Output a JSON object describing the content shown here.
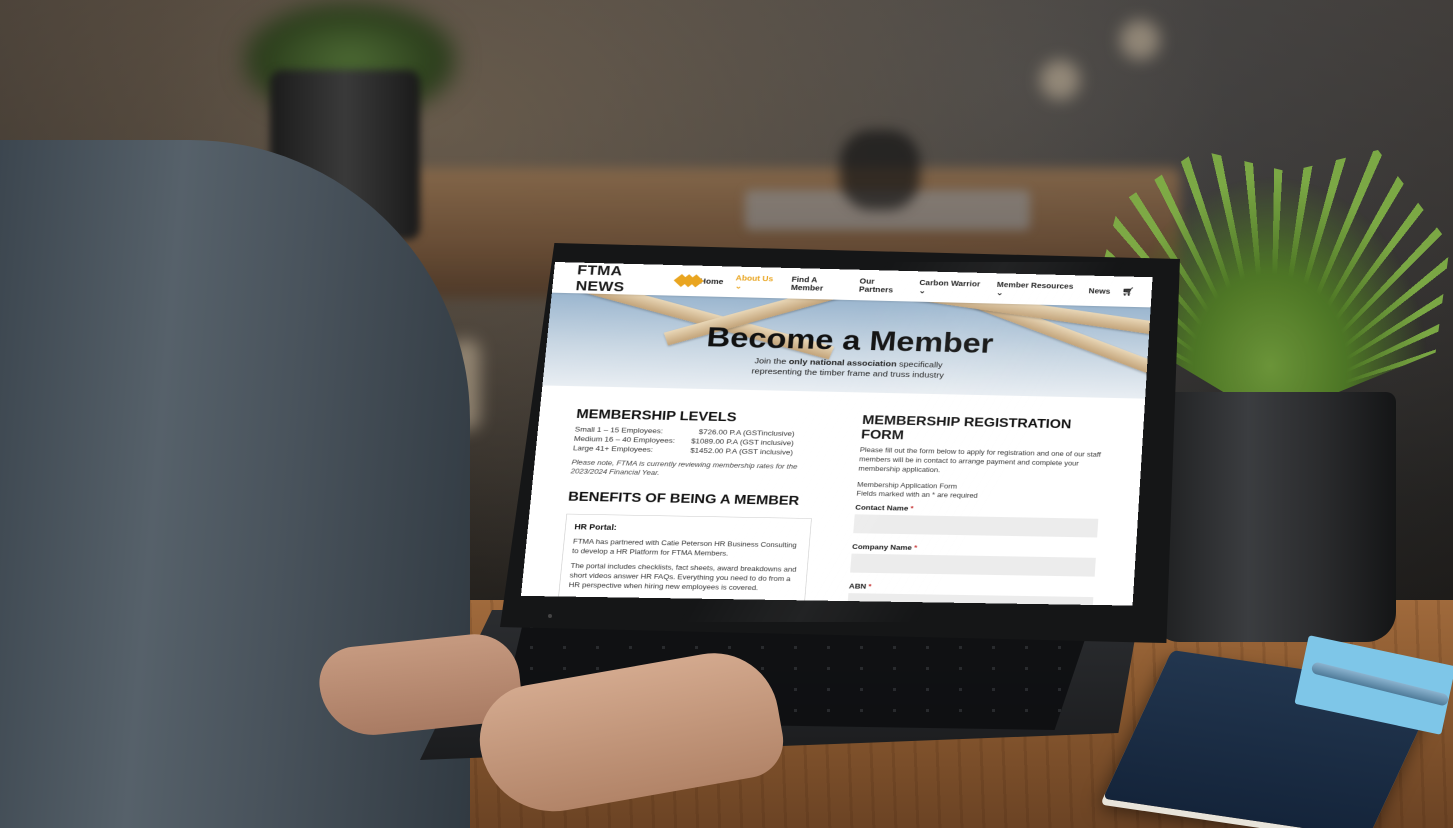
{
  "site": {
    "logo_text": "FTMA NEWS",
    "accent_color": "#e9a520",
    "nav": {
      "items": [
        "Home",
        "About Us ⌄",
        "Find A Member",
        "Our Partners",
        "Carbon Warrior ⌄",
        "Member Resources ⌄",
        "News"
      ],
      "active_index": 1,
      "cart_icon": "cart-icon"
    },
    "hero": {
      "title": "Become a Member",
      "sub_prefix": "Join the ",
      "sub_bold": "only national association",
      "sub_mid": " specifically",
      "sub_line2": "representing the timber frame and truss industry"
    },
    "membership": {
      "heading": "MEMBERSHIP LEVELS",
      "levels": [
        {
          "label": "Small 1 – 15 Employees:",
          "price": "$726.00 P.A (GSTinclusive)"
        },
        {
          "label": "Medium 16 – 40 Employees:",
          "price": "$1089.00 P.A (GST inclusive)"
        },
        {
          "label": "Large 41+ Employees:",
          "price": "$1452.00 P.A (GST inclusive)"
        }
      ],
      "note": "Please note, FTMA is currently reviewing membership rates for the 2023/2024 Financial Year."
    },
    "benefits": {
      "heading": "BENEFITS OF BEING A MEMBER",
      "card_title": "HR Portal:",
      "para1": "FTMA has partnered with Catie Peterson HR Business Consulting to develop a HR Platform for FTMA Members.",
      "para2": "The portal includes checklists, fact sheets, award breakdowns and short videos answer HR FAQs. Everything you need to do from a HR perspective when hiring new employees is covered."
    },
    "form": {
      "heading": "MEMBERSHIP REGISTRATION FORM",
      "intro": "Please fill out the form below to apply for registration and one of our staff members will be in contact to arrange payment and complete your membership application.",
      "form_name": "Membership Application Form",
      "required_note": "Fields marked with an * are required",
      "fields": [
        {
          "label": "Contact Name",
          "value": ""
        },
        {
          "label": "Company Name",
          "value": ""
        },
        {
          "label": "ABN",
          "value": ""
        }
      ],
      "required_mark": "*"
    }
  }
}
